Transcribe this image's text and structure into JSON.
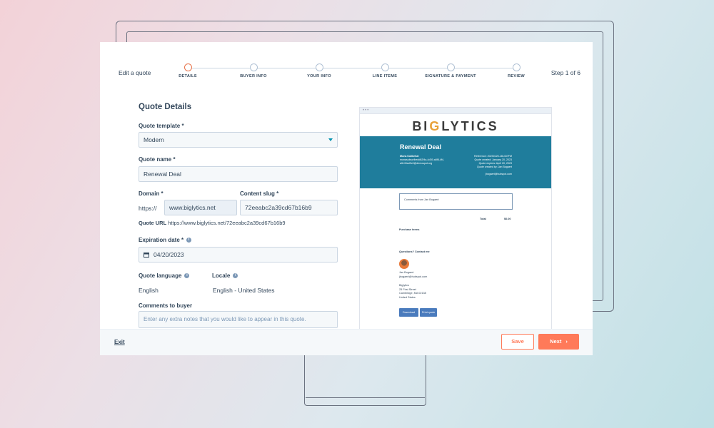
{
  "header": {
    "edit_label": "Edit a quote",
    "step_count": "Step 1 of 6",
    "steps": [
      {
        "label": "DETAILS",
        "active": true
      },
      {
        "label": "BUYER INFO",
        "active": false
      },
      {
        "label": "YOUR INFO",
        "active": false
      },
      {
        "label": "LINE ITEMS",
        "active": false
      },
      {
        "label": "SIGNATURE & PAYMENT",
        "active": false
      },
      {
        "label": "REVIEW",
        "active": false
      }
    ]
  },
  "form": {
    "title": "Quote Details",
    "template_label": "Quote template *",
    "template_value": "Modern",
    "name_label": "Quote name *",
    "name_value": "Renewal Deal",
    "domain_label": "Domain *",
    "domain_prefix": "https://",
    "domain_value": "www.biglytics.net",
    "slug_label": "Content slug *",
    "slug_value": "72eeabc2a39cd67b16b9",
    "url_label": "Quote URL",
    "url_value": "https://www.biglytics.net/72eeabc2a39cd67b16b9",
    "expiration_label": "Expiration date *",
    "expiration_value": "04/20/2023",
    "language_label": "Quote language",
    "language_value": "English",
    "locale_label": "Locale",
    "locale_value": "English - United States",
    "comments_label": "Comments to buyer",
    "comments_placeholder": "Enter any extra notes that you would like to appear in this quote."
  },
  "preview": {
    "dots": "•••",
    "logo_pre": "BI",
    "logo_g": "G",
    "logo_post": "LYTICS",
    "quote_title": "Renewal Deal",
    "buyer_name": "Mona Kulikehar",
    "buyer_email_1": "monasubscribedd62f4a-4d39-a8f8-4f4-",
    "buyer_email_2": "alt143ad9c0@demospot.org",
    "ref_line": "Reference: 20230120-181437FM",
    "created_line": "Quote created: January 20, 2023",
    "expires_line": "Quote expires: April 20, 2023",
    "created_by_line": "Quote created by: Jan Bogaert",
    "creator_email": "jbogaert@hubspot.com",
    "comments_from": "Comments from Jan Bogaert",
    "total_label": "Total",
    "total_value": "$0.00",
    "purchase_terms": "Purchase terms",
    "questions": "Questions? Contact me",
    "contact_name": "Jan Bogaert",
    "contact_email": "jbogaert@hubspot.com",
    "company": "Biglytics",
    "street": "25 First Street",
    "city": "Cambridge, MA 02138",
    "country": "United States",
    "download_btn": "Download",
    "print_btn": "Print quote"
  },
  "footer": {
    "exit_label": "Exit",
    "save_label": "Save",
    "next_label": "Next",
    "next_icon": "›"
  },
  "colors": {
    "accent": "#ff7a59",
    "active_step": "#e8734a",
    "preview_band": "#1f7d9c",
    "link": "#0091ae"
  }
}
